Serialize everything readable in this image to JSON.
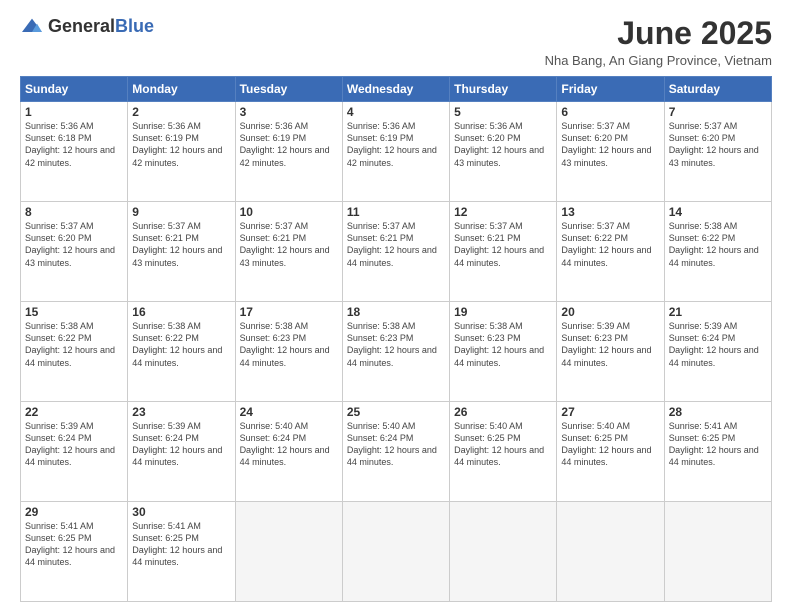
{
  "header": {
    "logo_general": "General",
    "logo_blue": "Blue",
    "month_title": "June 2025",
    "location": "Nha Bang, An Giang Province, Vietnam"
  },
  "weekdays": [
    "Sunday",
    "Monday",
    "Tuesday",
    "Wednesday",
    "Thursday",
    "Friday",
    "Saturday"
  ],
  "weeks": [
    [
      {
        "day": 1,
        "sunrise": "5:36 AM",
        "sunset": "6:18 PM",
        "daylight": "12 hours and 42 minutes."
      },
      {
        "day": 2,
        "sunrise": "5:36 AM",
        "sunset": "6:19 PM",
        "daylight": "12 hours and 42 minutes."
      },
      {
        "day": 3,
        "sunrise": "5:36 AM",
        "sunset": "6:19 PM",
        "daylight": "12 hours and 42 minutes."
      },
      {
        "day": 4,
        "sunrise": "5:36 AM",
        "sunset": "6:19 PM",
        "daylight": "12 hours and 42 minutes."
      },
      {
        "day": 5,
        "sunrise": "5:36 AM",
        "sunset": "6:20 PM",
        "daylight": "12 hours and 43 minutes."
      },
      {
        "day": 6,
        "sunrise": "5:37 AM",
        "sunset": "6:20 PM",
        "daylight": "12 hours and 43 minutes."
      },
      {
        "day": 7,
        "sunrise": "5:37 AM",
        "sunset": "6:20 PM",
        "daylight": "12 hours and 43 minutes."
      }
    ],
    [
      {
        "day": 8,
        "sunrise": "5:37 AM",
        "sunset": "6:20 PM",
        "daylight": "12 hours and 43 minutes."
      },
      {
        "day": 9,
        "sunrise": "5:37 AM",
        "sunset": "6:21 PM",
        "daylight": "12 hours and 43 minutes."
      },
      {
        "day": 10,
        "sunrise": "5:37 AM",
        "sunset": "6:21 PM",
        "daylight": "12 hours and 43 minutes."
      },
      {
        "day": 11,
        "sunrise": "5:37 AM",
        "sunset": "6:21 PM",
        "daylight": "12 hours and 44 minutes."
      },
      {
        "day": 12,
        "sunrise": "5:37 AM",
        "sunset": "6:21 PM",
        "daylight": "12 hours and 44 minutes."
      },
      {
        "day": 13,
        "sunrise": "5:37 AM",
        "sunset": "6:22 PM",
        "daylight": "12 hours and 44 minutes."
      },
      {
        "day": 14,
        "sunrise": "5:38 AM",
        "sunset": "6:22 PM",
        "daylight": "12 hours and 44 minutes."
      }
    ],
    [
      {
        "day": 15,
        "sunrise": "5:38 AM",
        "sunset": "6:22 PM",
        "daylight": "12 hours and 44 minutes."
      },
      {
        "day": 16,
        "sunrise": "5:38 AM",
        "sunset": "6:22 PM",
        "daylight": "12 hours and 44 minutes."
      },
      {
        "day": 17,
        "sunrise": "5:38 AM",
        "sunset": "6:23 PM",
        "daylight": "12 hours and 44 minutes."
      },
      {
        "day": 18,
        "sunrise": "5:38 AM",
        "sunset": "6:23 PM",
        "daylight": "12 hours and 44 minutes."
      },
      {
        "day": 19,
        "sunrise": "5:38 AM",
        "sunset": "6:23 PM",
        "daylight": "12 hours and 44 minutes."
      },
      {
        "day": 20,
        "sunrise": "5:39 AM",
        "sunset": "6:23 PM",
        "daylight": "12 hours and 44 minutes."
      },
      {
        "day": 21,
        "sunrise": "5:39 AM",
        "sunset": "6:24 PM",
        "daylight": "12 hours and 44 minutes."
      }
    ],
    [
      {
        "day": 22,
        "sunrise": "5:39 AM",
        "sunset": "6:24 PM",
        "daylight": "12 hours and 44 minutes."
      },
      {
        "day": 23,
        "sunrise": "5:39 AM",
        "sunset": "6:24 PM",
        "daylight": "12 hours and 44 minutes."
      },
      {
        "day": 24,
        "sunrise": "5:40 AM",
        "sunset": "6:24 PM",
        "daylight": "12 hours and 44 minutes."
      },
      {
        "day": 25,
        "sunrise": "5:40 AM",
        "sunset": "6:24 PM",
        "daylight": "12 hours and 44 minutes."
      },
      {
        "day": 26,
        "sunrise": "5:40 AM",
        "sunset": "6:25 PM",
        "daylight": "12 hours and 44 minutes."
      },
      {
        "day": 27,
        "sunrise": "5:40 AM",
        "sunset": "6:25 PM",
        "daylight": "12 hours and 44 minutes."
      },
      {
        "day": 28,
        "sunrise": "5:41 AM",
        "sunset": "6:25 PM",
        "daylight": "12 hours and 44 minutes."
      }
    ],
    [
      {
        "day": 29,
        "sunrise": "5:41 AM",
        "sunset": "6:25 PM",
        "daylight": "12 hours and 44 minutes."
      },
      {
        "day": 30,
        "sunrise": "5:41 AM",
        "sunset": "6:25 PM",
        "daylight": "12 hours and 44 minutes."
      },
      null,
      null,
      null,
      null,
      null
    ]
  ]
}
